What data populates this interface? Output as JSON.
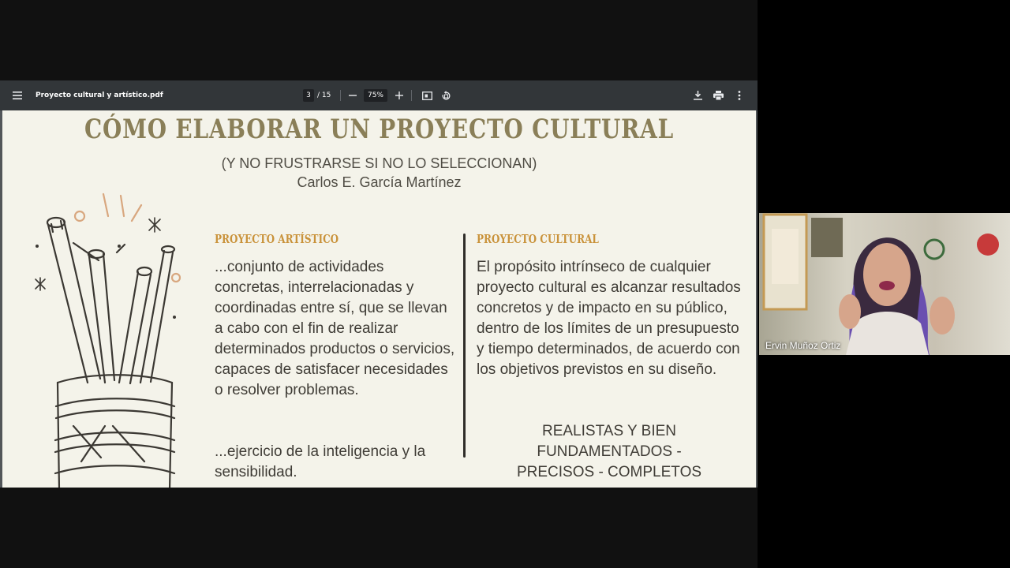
{
  "viewer": {
    "file_title": "Proyecto cultural y artístico.pdf",
    "current_page": "3",
    "page_total": "/ 15",
    "zoom": "75%",
    "icons": [
      "menu-icon",
      "zoom-out-icon",
      "zoom-in-icon",
      "fit-page-icon",
      "rotate-icon",
      "download-icon",
      "print-icon",
      "more-vert-icon"
    ]
  },
  "slide": {
    "title": "CÓMO ELABORAR UN PROYECTO CULTURAL",
    "subtitle": "(Y NO FRUSTRARSE SI NO LO SELECCIONAN)",
    "author": "Carlos E. García Martínez",
    "artistic": {
      "heading": "PROYECTO ARTÍSTICO",
      "text1": "...conjunto de actividades concretas, interrelacionadas y coordinadas entre sí, que se llevan a cabo con el fin de realizar determinados productos o servicios, capaces de satisfacer necesidades o resolver problemas.",
      "text2": "...ejercicio de la inteligencia y la sensibilidad."
    },
    "cultural": {
      "heading": "PROYECTO CULTURAL",
      "text": "El propósito intrínseco de cualquier proyecto cultural es alcanzar resultados concretos y de impacto en su público, dentro de los límites de un presupuesto y tiempo determinados, de acuerdo con los objetivos previstos en su diseño.",
      "motto": "REALISTAS Y BIEN FUNDAMENTADOS - PRECISOS - COMPLETOS"
    }
  },
  "participant": {
    "name": "Ervin Muñoz Ortiz"
  },
  "colors": {
    "toolbar": "#323639",
    "slide_bg": "#f4f3ea",
    "title": "#8a7f58",
    "heading": "#c9923a"
  }
}
